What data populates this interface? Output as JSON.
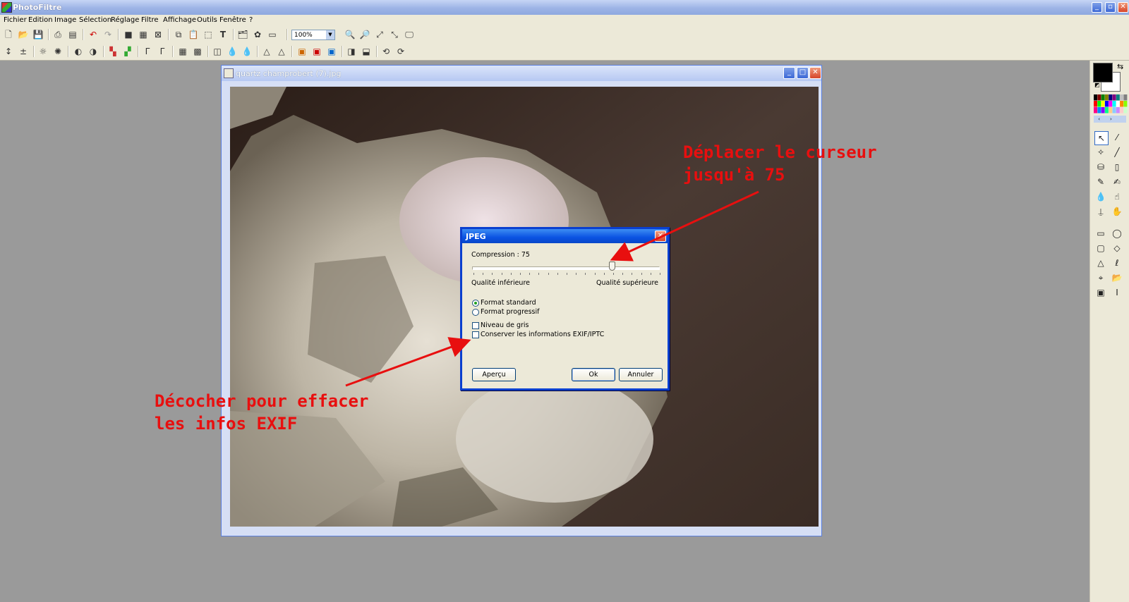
{
  "app": {
    "title": "PhotoFiltre"
  },
  "menu": [
    "Fichier",
    "Edition",
    "Image",
    "Sélection",
    "Réglage",
    "Filtre",
    "Affichage",
    "Outils",
    "Fenêtre",
    "?"
  ],
  "toolbar": {
    "zoom_value": "100%"
  },
  "document": {
    "title": "quartz champrobert (7).jpg"
  },
  "dialog": {
    "title": "JPEG",
    "compression_label": "Compression : 75",
    "compression_value": 75,
    "slider_min_label": "Qualité inférieure",
    "slider_max_label": "Qualité supérieure",
    "format_standard": "Format standard",
    "format_progressive": "Format progressif",
    "selected_format": "standard",
    "grayscale_label": "Niveau de gris",
    "grayscale_checked": false,
    "exif_label": "Conserver les informations EXIF/IPTC",
    "exif_checked": false,
    "preview_button": "Aperçu",
    "ok_button": "Ok",
    "cancel_button": "Annuler"
  },
  "annotations": {
    "slider_note": "Déplacer le curseur\njusqu'à 75",
    "exif_note": "Décocher pour effacer\nles infos EXIF",
    "color": "#e80f0f"
  }
}
